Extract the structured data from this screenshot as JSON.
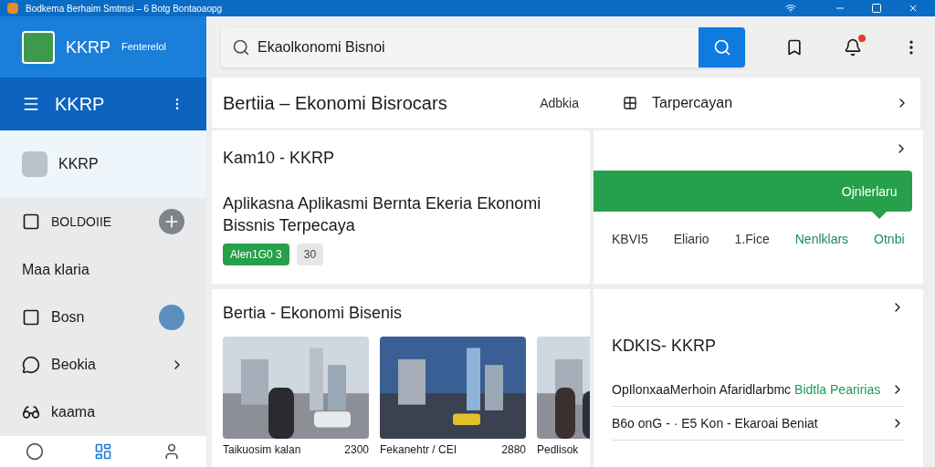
{
  "window": {
    "title": "Bodkema Berhaim Smtmsi – 6 Botg Bontaoaopg"
  },
  "brand": {
    "name": "KKRP",
    "subtitle": "Fenterelol"
  },
  "app_bar": {
    "title": "KKRP"
  },
  "sidebar": {
    "items": [
      {
        "kind": "profile",
        "label": "KKRP",
        "selected": true
      },
      {
        "kind": "add",
        "label": "BOLDOIIE",
        "selected": false
      },
      {
        "kind": "plain",
        "label": "Maa klaria",
        "selected": false
      },
      {
        "kind": "avatar",
        "label": "Bosn",
        "selected": false
      },
      {
        "kind": "chevron",
        "label": "Beokia",
        "selected": false
      },
      {
        "kind": "glasses",
        "label": "kaama",
        "selected": false
      }
    ]
  },
  "bottom_nav": [
    {
      "selected": false
    },
    {
      "selected": true
    },
    {
      "selected": false
    }
  ],
  "search": {
    "value": "Ekaolkonomi Bisnoi"
  },
  "notifications": {
    "badge": true
  },
  "header": {
    "title": "Bertiia – Ekonomi Bisrocars",
    "link": "Adbkia",
    "view": "Tarpercayan"
  },
  "feature_card": {
    "title": "Kam10 - KKRP",
    "description": "Aplikasna Aplikasmi Bernta Ekeria Ekonomi Bissnis Terpecaya",
    "tags": [
      {
        "label": "Alen1G0 3",
        "kind": "green"
      },
      {
        "label": "30",
        "kind": "gray"
      }
    ]
  },
  "tip_card": {
    "banner": "Ojnlerlaru",
    "tabs": [
      {
        "label": "KBVI5",
        "selected": false
      },
      {
        "label": "Eliario",
        "selected": false
      },
      {
        "label": "1.Fice",
        "selected": false
      },
      {
        "label": "Nenlklars",
        "selected": true
      },
      {
        "label": "Otnbi",
        "selected": true
      }
    ]
  },
  "news": {
    "title": "Bertia - Ekonomi Bisenis",
    "items": [
      {
        "caption": "Taikuosim kalan",
        "count": "2300"
      },
      {
        "caption": "Fekanehtr / CEI",
        "count": "2880"
      },
      {
        "caption": "Pedlisok"
      }
    ]
  },
  "list_card": {
    "title": "KDKIS- KKRP",
    "items": [
      {
        "text": "OpIlonxaaMerhoin Afaridlarbmc",
        "accent": "Bidtla Pearirias"
      },
      {
        "text": "B6o onG - · E5 Kon - Ekaroai Beniat"
      }
    ]
  }
}
